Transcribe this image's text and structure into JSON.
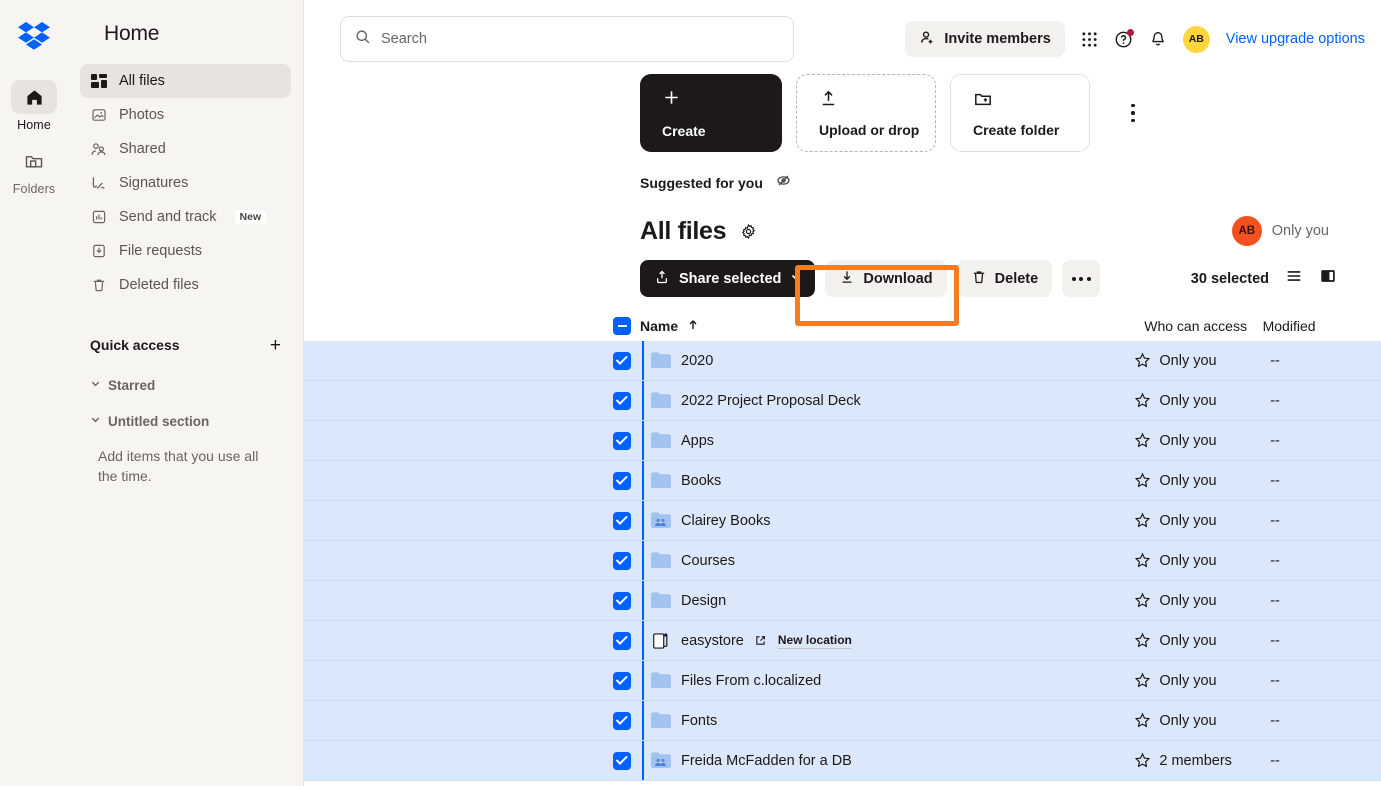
{
  "rail": {
    "logo": "dropbox-logo",
    "items": [
      {
        "label": "Home",
        "icon": "home-icon",
        "active": true
      },
      {
        "label": "Folders",
        "icon": "folders-icon",
        "active": false
      }
    ]
  },
  "sidebar": {
    "title": "Home",
    "nav": [
      {
        "label": "All files",
        "icon": "all-files-icon",
        "badge": ""
      },
      {
        "label": "Photos",
        "icon": "photos-icon",
        "badge": ""
      },
      {
        "label": "Shared",
        "icon": "shared-icon",
        "badge": ""
      },
      {
        "label": "Signatures",
        "icon": "signatures-icon",
        "badge": ""
      },
      {
        "label": "Send and track",
        "icon": "send-and-track-icon",
        "badge": "New"
      },
      {
        "label": "File requests",
        "icon": "file-requests-icon",
        "badge": ""
      },
      {
        "label": "Deleted files",
        "icon": "trash-icon",
        "badge": ""
      }
    ],
    "quick_access": {
      "title": "Quick access",
      "add_label": "+",
      "sections": [
        {
          "label": "Starred"
        },
        {
          "label": "Untitled section"
        }
      ],
      "hint": "Add items that you use all the time."
    }
  },
  "topbar": {
    "search": {
      "placeholder": "Search",
      "value": ""
    },
    "invite_label": "Invite members",
    "grid_icon": "apps-grid-icon",
    "help_icon": "help-circle-icon",
    "bell_icon": "notification-bell-icon",
    "avatar_initials": "AB",
    "upgrade_label": "View upgrade options"
  },
  "actions": {
    "cards": [
      {
        "label": "Create",
        "icon": "plus-icon",
        "style": "dark"
      },
      {
        "label": "Upload or drop",
        "icon": "upload-icon",
        "style": "dashed"
      },
      {
        "label": "Create folder",
        "icon": "folder-plus-icon",
        "style": "solid"
      }
    ],
    "kebab_icon": "more-vertical-icon"
  },
  "suggested": {
    "label": "Suggested for you",
    "hide_icon": "eye-off-icon"
  },
  "files_header": {
    "title": "All files",
    "gear_icon": "gear-icon",
    "avatar_initials": "AB",
    "access_label": "Only you"
  },
  "toolbar": {
    "share_label": "Share selected",
    "share_icon": "share-icon",
    "chevron_icon": "chevron-down-icon",
    "download_label": "Download",
    "download_icon": "download-icon",
    "delete_label": "Delete",
    "delete_icon": "trash-icon",
    "more_icon": "more-horizontal-icon",
    "selected_count": "30 selected",
    "list_view_icon": "list-view-icon",
    "split_view_icon": "split-pane-icon",
    "highlight_color": "#f57c1f",
    "highlighted_button": "Download"
  },
  "table": {
    "columns": [
      "Name",
      "Who can access",
      "Modified"
    ],
    "sort_icon": "arrow-up-icon",
    "select_all_state": "indeterminate",
    "rows": [
      {
        "name": "2020",
        "icon": "folder-icon",
        "access": "Only you",
        "modified": "--",
        "checked": true,
        "new_location": false
      },
      {
        "name": "2022 Project Proposal Deck",
        "icon": "folder-icon",
        "access": "Only you",
        "modified": "--",
        "checked": true,
        "new_location": false
      },
      {
        "name": "Apps",
        "icon": "folder-icon",
        "access": "Only you",
        "modified": "--",
        "checked": true,
        "new_location": false
      },
      {
        "name": "Books",
        "icon": "folder-icon",
        "access": "Only you",
        "modified": "--",
        "checked": true,
        "new_location": false
      },
      {
        "name": "Clairey Books",
        "icon": "shared-folder-icon",
        "access": "Only you",
        "modified": "--",
        "checked": true,
        "new_location": false
      },
      {
        "name": "Courses",
        "icon": "folder-icon",
        "access": "Only you",
        "modified": "--",
        "checked": true,
        "new_location": false
      },
      {
        "name": "Design",
        "icon": "folder-icon",
        "access": "Only you",
        "modified": "--",
        "checked": true,
        "new_location": false
      },
      {
        "name": "easystore",
        "icon": "external-drive-icon",
        "access": "Only you",
        "modified": "--",
        "checked": true,
        "new_location": true,
        "new_location_label": "New location"
      },
      {
        "name": "Files From c.localized",
        "icon": "folder-icon",
        "access": "Only you",
        "modified": "--",
        "checked": true,
        "new_location": false
      },
      {
        "name": "Fonts",
        "icon": "folder-icon",
        "access": "Only you",
        "modified": "--",
        "checked": true,
        "new_location": false
      },
      {
        "name": "Freida McFadden for a DB",
        "icon": "shared-folder-icon",
        "access": "2 members",
        "modified": "--",
        "checked": true,
        "new_location": false
      }
    ]
  },
  "colors": {
    "accent_blue": "#0061fe",
    "row_selected": "#dbe7fb",
    "sidebar_bg": "#f7f5f2",
    "dark": "#1e1919",
    "highlight_orange": "#f57c1f",
    "avatar_yellow": "#ffd63d",
    "avatar_orange": "#f4511e"
  }
}
